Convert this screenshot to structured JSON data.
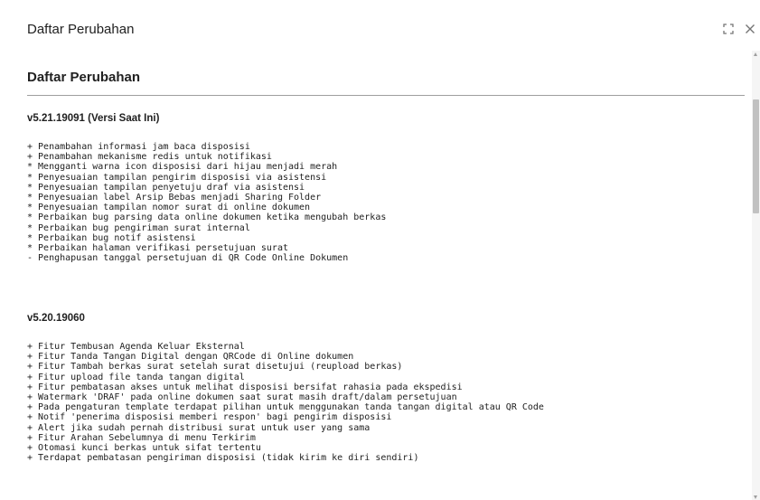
{
  "dialog": {
    "title": "Daftar Perubahan",
    "maximize_icon": "maximize-icon",
    "close_icon": "close-icon"
  },
  "content": {
    "title": "Daftar Perubahan",
    "releases": [
      {
        "version": "v5.21.19091 (Versi Saat Ini)",
        "notes": [
          "+ Penambahan informasi jam baca disposisi",
          "+ Penambahan mekanisme redis untuk notifikasi",
          "* Mengganti warna icon disposisi dari hijau menjadi merah",
          "* Penyesuaian tampilan pengirim disposisi via asistensi",
          "* Penyesuaian tampilan penyetuju draf via asistensi",
          "* Penyesuaian label Arsip Bebas menjadi Sharing Folder",
          "* Penyesuaian tampilan nomor surat di online dokumen",
          "* Perbaikan bug parsing data online dokumen ketika mengubah berkas",
          "* Perbaikan bug pengiriman surat internal",
          "* Perbaikan bug notif asistensi",
          "* Perbaikan halaman verifikasi persetujuan surat",
          "- Penghapusan tanggal persetujuan di QR Code Online Dokumen"
        ]
      },
      {
        "version": "v5.20.19060",
        "notes": [
          "+ Fitur Tembusan Agenda Keluar Eksternal",
          "+ Fitur Tanda Tangan Digital dengan QRCode di Online dokumen",
          "+ Fitur Tambah berkas surat setelah surat disetujui (reupload berkas)",
          "+ Fitur upload file tanda tangan digital",
          "+ Fitur pembatasan akses untuk melihat disposisi bersifat rahasia pada ekspedisi",
          "+ Watermark 'DRAF' pada online dokumen saat surat masih draft/dalam persetujuan",
          "+ Pada pengaturan template terdapat pilihan untuk menggunakan tanda tangan digital atau QR Code",
          "+ Notif 'penerima disposisi memberi respon' bagi pengirim disposisi",
          "+ Alert jika sudah pernah distribusi surat untuk user yang sama",
          "+ Fitur Arahan Sebelumnya di menu Terkirim",
          "+ Otomasi kunci berkas untuk sifat tertentu",
          "+ Terdapat pembatasan pengiriman disposisi (tidak kirim ke diri sendiri)"
        ]
      }
    ]
  },
  "colors": {
    "text": "#212121",
    "divider": "#9e9e9e",
    "scroll_thumb": "#c1c1c1",
    "icon": "#757575"
  }
}
